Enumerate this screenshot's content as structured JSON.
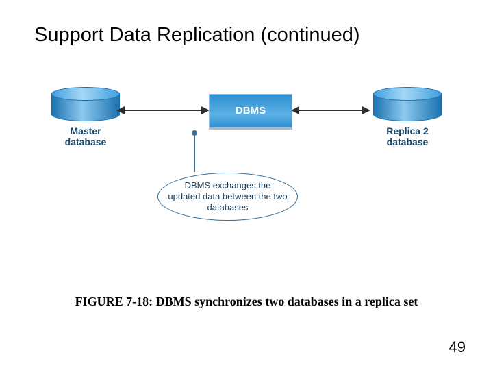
{
  "title": "Support Data Replication (continued)",
  "diagram": {
    "master_label_line1": "Master",
    "master_label_line2": "database",
    "dbms_label": "DBMS",
    "replica_label_line1": "Replica 2",
    "replica_label_line2": "database",
    "callout_text": "DBMS exchanges the updated data between the two databases"
  },
  "caption": "FIGURE 7-18: DBMS synchronizes two databases in a replica set",
  "page_number": "49"
}
